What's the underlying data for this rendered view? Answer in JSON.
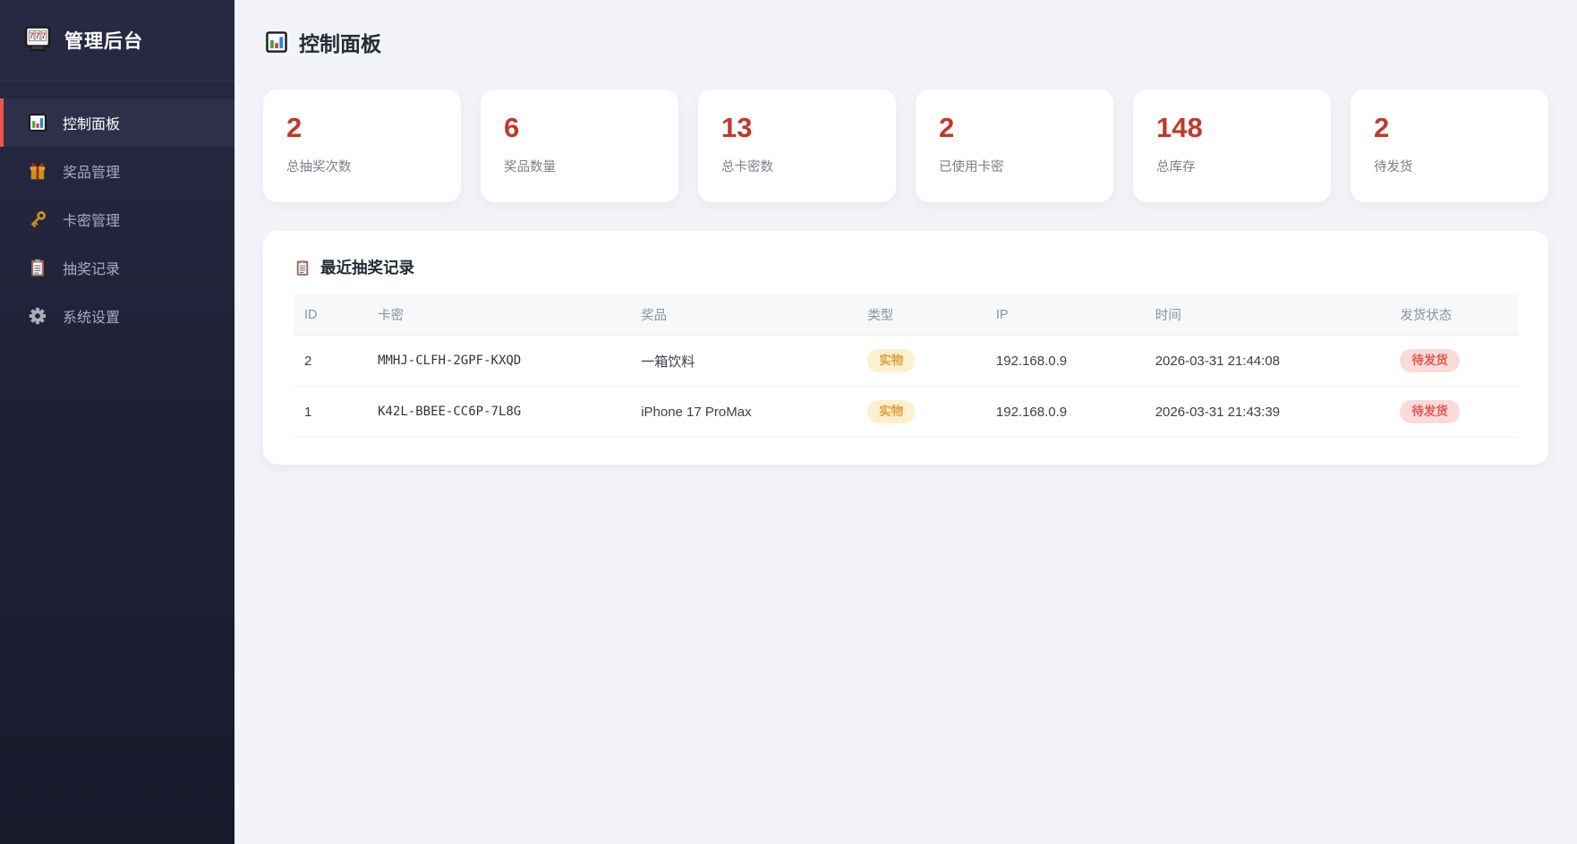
{
  "colors": {
    "stat_number_red": "#c0392b",
    "sidebar_active_border": "#ee544b",
    "type_badge_bg": "#fdf0cd",
    "type_badge_text": "#e89d3c",
    "status_badge_bg": "#f9dbda",
    "status_badge_text": "#e8574f"
  },
  "sidebar": {
    "title": "管理后台",
    "logo_icon": "slot-machine-icon",
    "items": [
      {
        "label": "控制面板",
        "icon": "bar-chart-icon",
        "active": true
      },
      {
        "label": "奖品管理",
        "icon": "gift-icon",
        "active": false
      },
      {
        "label": "卡密管理",
        "icon": "key-icon",
        "active": false
      },
      {
        "label": "抽奖记录",
        "icon": "clipboard-icon",
        "active": false
      },
      {
        "label": "系统设置",
        "icon": "gear-icon",
        "active": false
      }
    ]
  },
  "header": {
    "title": "控制面板",
    "icon": "bar-chart-icon"
  },
  "stats": [
    {
      "value": "2",
      "label": "总抽奖次数"
    },
    {
      "value": "6",
      "label": "奖品数量"
    },
    {
      "value": "13",
      "label": "总卡密数"
    },
    {
      "value": "2",
      "label": "已使用卡密"
    },
    {
      "value": "148",
      "label": "总库存"
    },
    {
      "value": "2",
      "label": "待发货"
    }
  ],
  "recent_panel": {
    "title": "最近抽奖记录",
    "icon": "clipboard-icon",
    "columns": [
      "ID",
      "卡密",
      "奖品",
      "类型",
      "IP",
      "时间",
      "发货状态"
    ],
    "rows": [
      {
        "id": "2",
        "key": "MMHJ-CLFH-2GPF-KXQD",
        "prize": "一箱饮料",
        "type": "实物",
        "ip": "192.168.0.9",
        "time": "2026-03-31 21:44:08",
        "status": "待发货"
      },
      {
        "id": "1",
        "key": "K42L-BBEE-CC6P-7L8G",
        "prize": "iPhone 17 ProMax",
        "type": "实物",
        "ip": "192.168.0.9",
        "time": "2026-03-31 21:43:39",
        "status": "待发货"
      }
    ]
  }
}
